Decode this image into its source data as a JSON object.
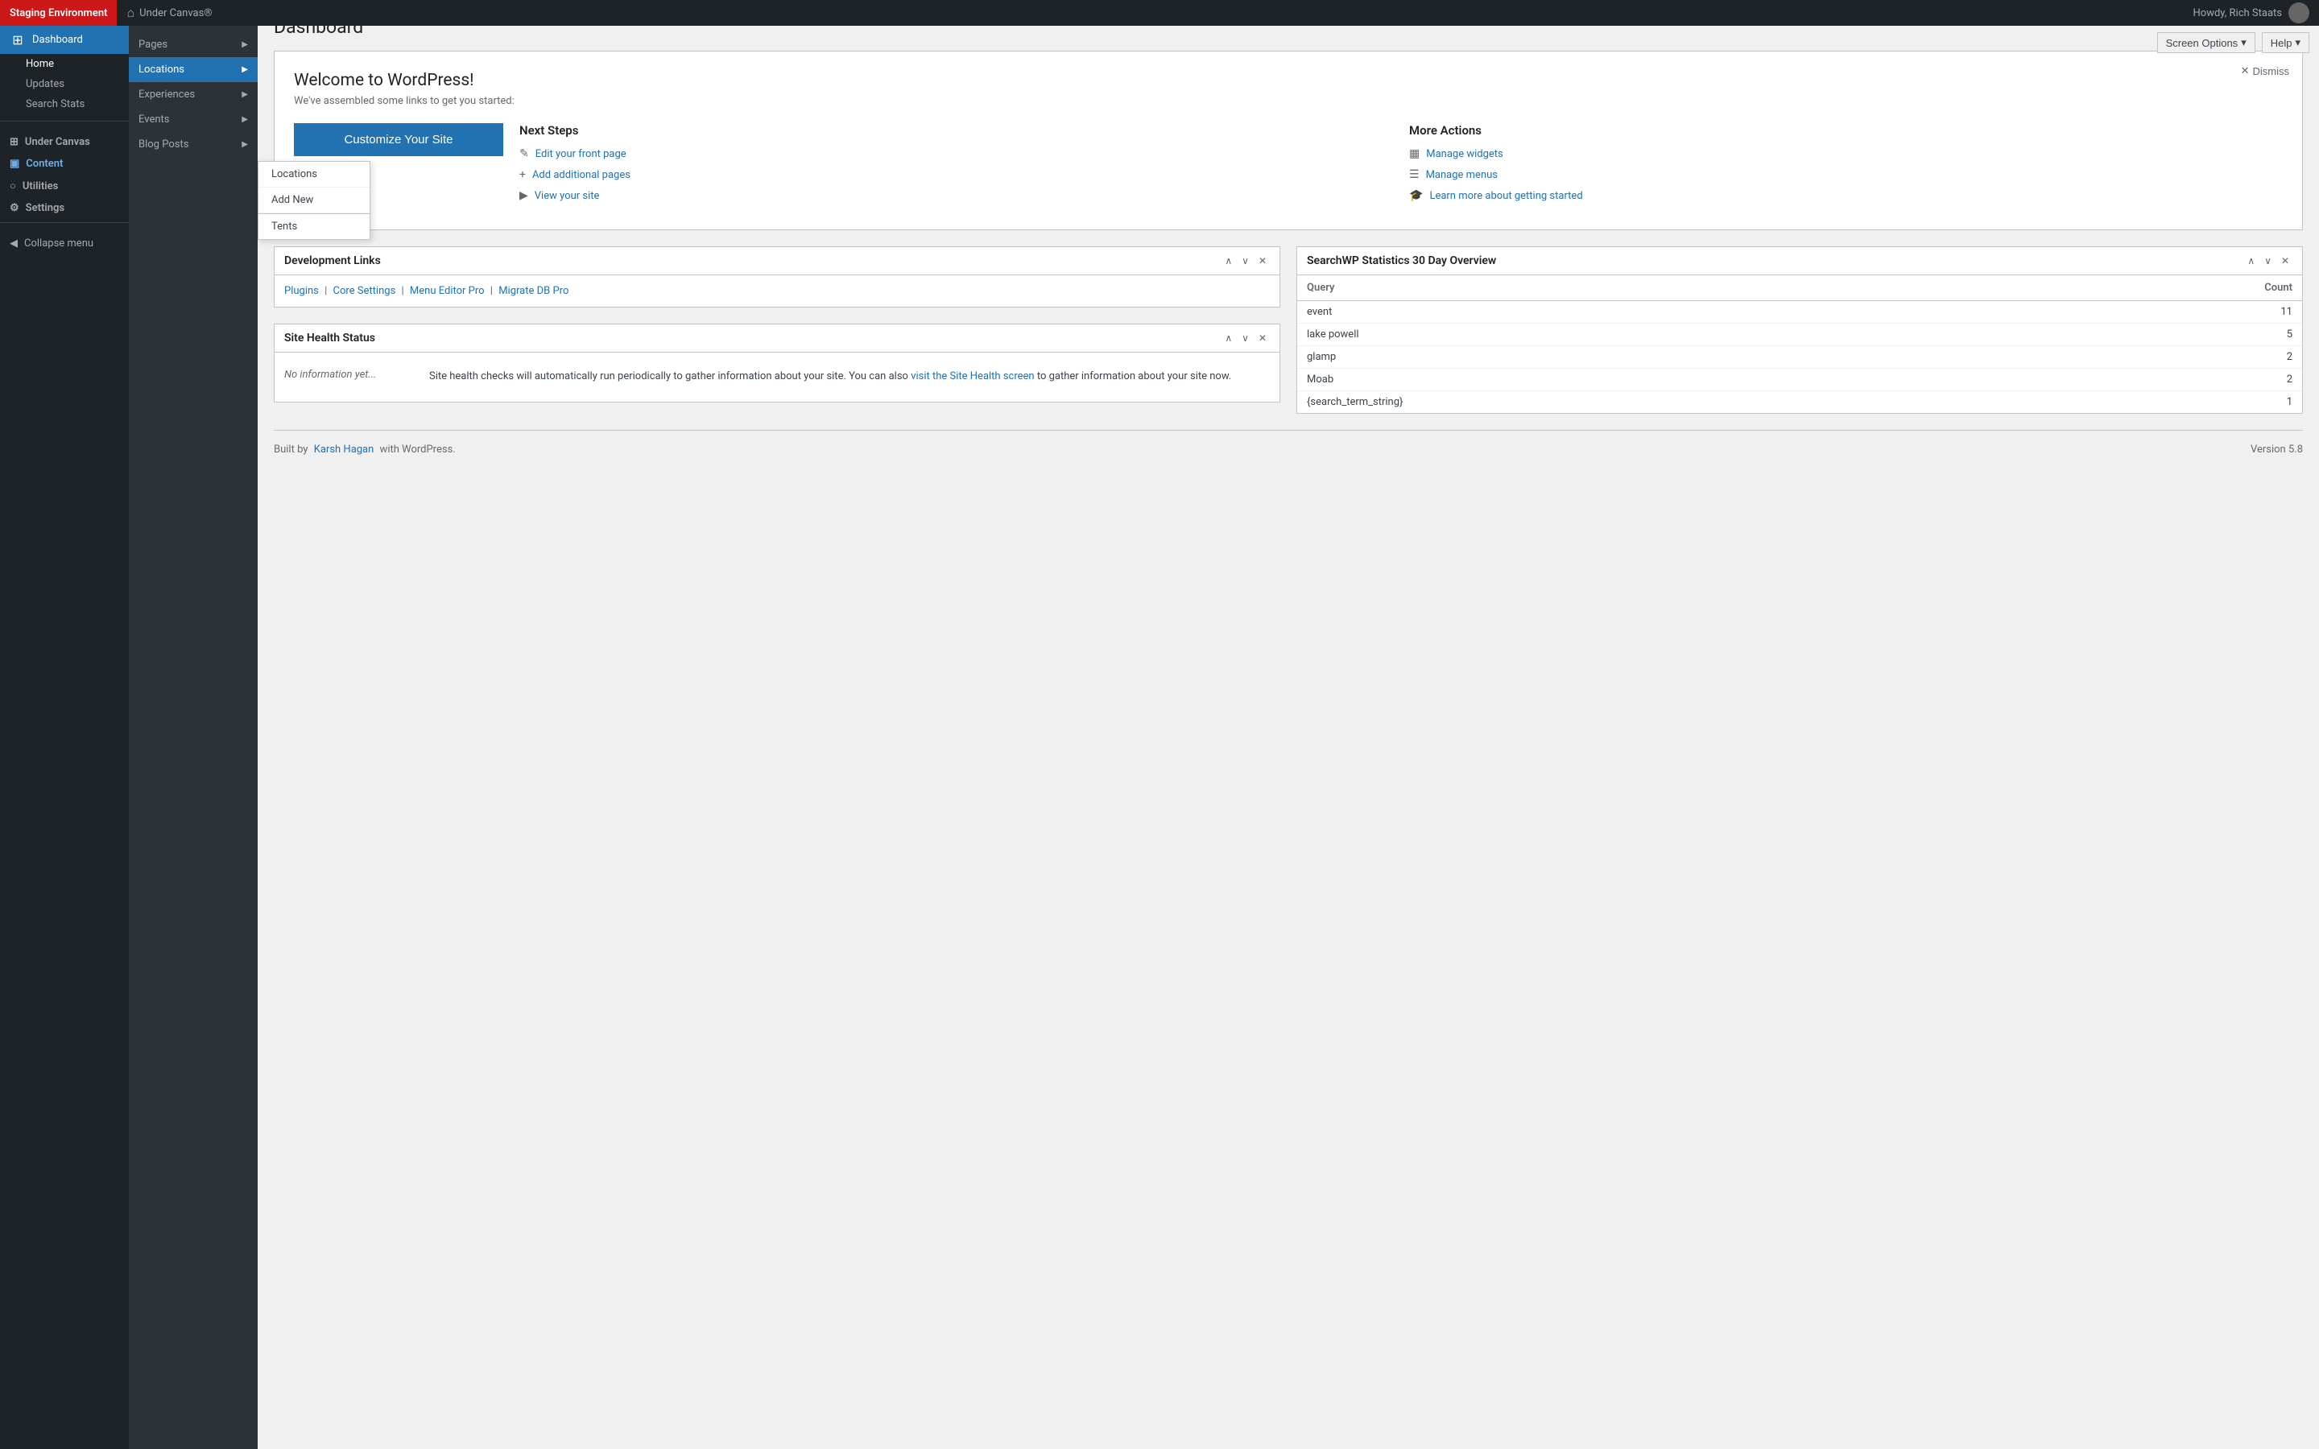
{
  "adminBar": {
    "staging_label": "Staging Environment",
    "site_icon": "⌂",
    "site_name": "Under Canvas®",
    "howdy_text": "Howdy, Rich Staats"
  },
  "sidebar": {
    "home_label": "Home",
    "updates_label": "Updates",
    "search_stats_label": "Search Stats",
    "under_canvas_label": "Under Canvas",
    "content_label": "Content",
    "utilities_label": "Utilities",
    "settings_label": "Settings",
    "collapse_label": "Collapse menu",
    "sub_pages": "Pages",
    "sub_locations": "Locations",
    "sub_experiences": "Experiences",
    "sub_events": "Events",
    "sub_blog_posts": "Blog Posts"
  },
  "topBar": {
    "screen_options_label": "Screen Options",
    "help_label": "Help"
  },
  "page": {
    "title": "Dashboard"
  },
  "welcome": {
    "title": "Welcome to WordPress!",
    "subtitle": "We've assembled some links to get you started:",
    "dismiss_label": "Dismiss",
    "customize_btn": "Customize Your Site",
    "next_steps_title": "Next Steps",
    "more_actions_title": "More Actions",
    "steps": [
      {
        "icon": "✎",
        "label": "Edit your front page"
      },
      {
        "icon": "+",
        "label": "Add additional pages"
      },
      {
        "icon": "▶",
        "label": "View your site"
      }
    ],
    "more_actions": [
      {
        "icon": "▦",
        "label": "Manage widgets"
      },
      {
        "icon": "☰",
        "label": "Manage menus"
      },
      {
        "icon": "🎓",
        "label": "Learn more about getting started"
      }
    ]
  },
  "devLinks": {
    "title": "Development Links",
    "links": [
      {
        "label": "Plugins"
      },
      {
        "label": "Core Settings"
      },
      {
        "label": "Menu Editor Pro"
      },
      {
        "label": "Migrate DB Pro"
      }
    ]
  },
  "siteHealth": {
    "title": "Site Health Status",
    "no_info": "No information yet...",
    "description": "Site health checks will automatically run periodically to gather information about your site. You can also",
    "link_text": "visit the Site Health screen",
    "description2": "to gather information about your site now."
  },
  "searchStats": {
    "title": "SearchWP Statistics 30 Day Overview",
    "col_query": "Query",
    "col_count": "Count",
    "rows": [
      {
        "query": "event",
        "count": "11"
      },
      {
        "query": "lake powell",
        "count": "5"
      },
      {
        "query": "glamp",
        "count": "2"
      },
      {
        "query": "Moab",
        "count": "2"
      },
      {
        "query": "{search_term_string}",
        "count": "1"
      }
    ]
  },
  "footer": {
    "built_by": "Built by",
    "author": "Karsh Hagan",
    "with_wp": "with WordPress.",
    "version": "Version 5.8"
  },
  "locationsFlyout": {
    "items": [
      {
        "label": "Locations"
      },
      {
        "label": "Add New"
      },
      {
        "label": "Tents"
      }
    ]
  },
  "colors": {
    "staging_red": "#cc1818",
    "sidebar_bg": "#1d2327",
    "active_blue": "#2271b1",
    "content_sidebar": "#2c3338"
  }
}
